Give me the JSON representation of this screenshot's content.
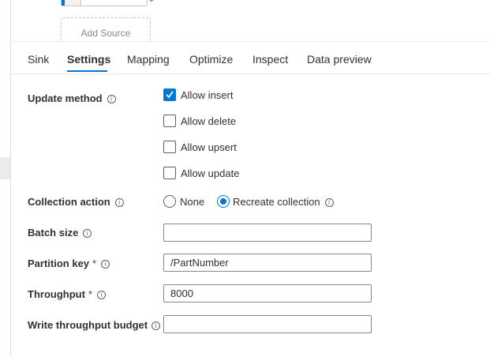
{
  "canvas": {
    "add_source_label": "Add Source",
    "plus_glyph": "+"
  },
  "tabs": [
    {
      "label": "Sink",
      "active": false
    },
    {
      "label": "Settings",
      "active": true
    },
    {
      "label": "Mapping",
      "active": false
    },
    {
      "label": "Optimize",
      "active": false
    },
    {
      "label": "Inspect",
      "active": false
    },
    {
      "label": "Data preview",
      "active": false
    }
  ],
  "info_glyph": "i",
  "form": {
    "update_method": {
      "label": "Update method",
      "options": [
        {
          "label": "Allow insert",
          "checked": true
        },
        {
          "label": "Allow delete",
          "checked": false
        },
        {
          "label": "Allow upsert",
          "checked": false
        },
        {
          "label": "Allow update",
          "checked": false
        }
      ]
    },
    "collection_action": {
      "label": "Collection action",
      "options": [
        {
          "label": "None",
          "selected": false
        },
        {
          "label": "Recreate collection",
          "selected": true
        }
      ]
    },
    "batch_size": {
      "label": "Batch size",
      "value": ""
    },
    "partition_key": {
      "label": "Partition key",
      "required_mark": "*",
      "value": "/PartNumber"
    },
    "throughput": {
      "label": "Throughput",
      "required_mark": "*",
      "value": "8000"
    },
    "write_throughput_budget": {
      "label": "Write throughput budget",
      "value": ""
    }
  },
  "colors": {
    "accent": "#0078d4",
    "required": "#a4262c",
    "text": "#323130",
    "border": "#8a8886"
  }
}
